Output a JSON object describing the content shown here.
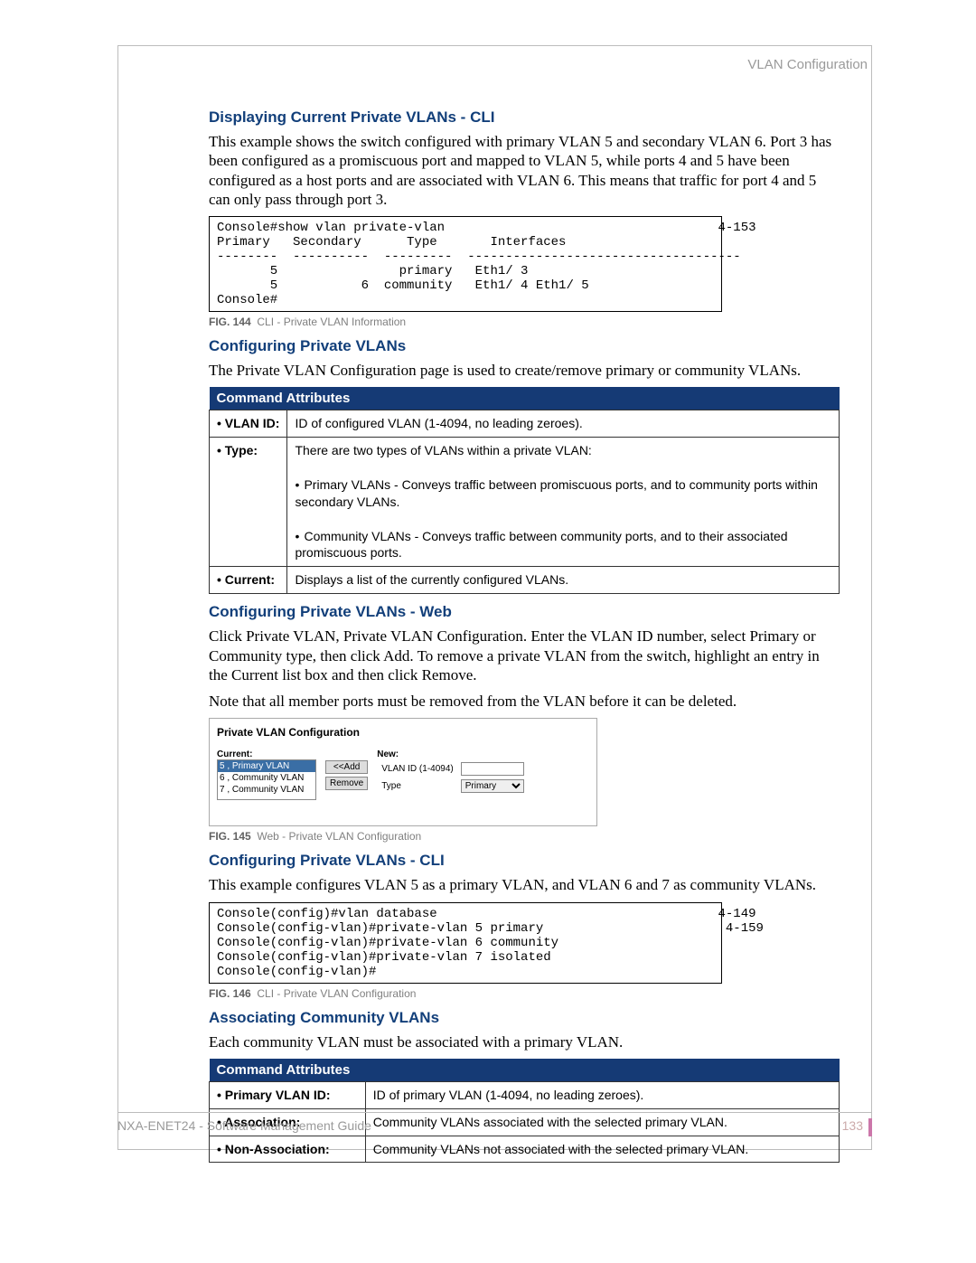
{
  "header": {
    "section": "VLAN Configuration"
  },
  "sections": {
    "s1": {
      "title": "Displaying Current Private VLANs - CLI",
      "para": "This example shows the switch configured with primary VLAN 5 and secondary VLAN 6. Port 3 has been configured as a promiscuous port and mapped to VLAN 5, while ports 4 and 5 have been configured as a host ports and are associated with VLAN 6. This means that traffic for port 4 and 5 can only pass through port 3."
    },
    "cli1": {
      "ref": "4-153",
      "text": "Console#show vlan private-vlan                                    4-153\nPrimary   Secondary      Type       Interfaces\n--------  ----------  ---------  ------------------------------------\n       5                primary   Eth1/ 3\n       5           6  community   Eth1/ 4 Eth1/ 5\nConsole#"
    },
    "fig144": {
      "num": "FIG. 144",
      "caption": "CLI - Private VLAN Information"
    },
    "s2": {
      "title": "Configuring Private VLANs",
      "para": "The Private VLAN Configuration page is used to create/remove primary or community VLANs."
    },
    "attr1": {
      "header": "Command Attributes",
      "rows": [
        {
          "label": "• VLAN ID:",
          "desc": "ID of configured VLAN (1-4094, no leading zeroes)."
        },
        {
          "label": "• Type:",
          "desc": "There are two types of VLANs within a private VLAN:",
          "sub": [
            "Primary VLANs - Conveys traffic between promiscuous ports, and to community ports within secondary VLANs.",
            "Community VLANs - Conveys traffic between community ports, and to their associated promiscuous ports."
          ]
        },
        {
          "label": "• Current:",
          "desc": "Displays a list of the currently configured VLANs."
        }
      ]
    },
    "s3": {
      "title": "Configuring Private VLANs - Web",
      "para1": "Click Private VLAN, Private VLAN Configuration. Enter the VLAN ID number, select Primary or Community type, then click Add. To remove a private VLAN from the switch, highlight an entry in the Current list box and then click Remove.",
      "para2": "Note that all member ports must be removed from the VLAN before it can be deleted."
    },
    "webshot": {
      "title": "Private VLAN Configuration",
      "currentLabel": "Current:",
      "newLabel": "New:",
      "listItems": [
        "5 , Primary VLAN",
        "6 , Community VLAN",
        "7 , Community VLAN"
      ],
      "addBtn": "<<Add",
      "removeBtn": "Remove",
      "vlanIdLabel": "VLAN ID (1-4094)",
      "typeLabel": "Type",
      "typeValue": "Primary"
    },
    "fig145": {
      "num": "FIG. 145",
      "caption": "Web - Private VLAN Configuration"
    },
    "s4": {
      "title": "Configuring Private VLANs - CLI",
      "para": "This example configures VLAN 5 as a primary VLAN, and VLAN 6 and 7 as community VLANs."
    },
    "cli2": {
      "text": "Console(config)#vlan database                                     4-149\nConsole(config-vlan)#private-vlan 5 primary                        4-159\nConsole(config-vlan)#private-vlan 6 community\nConsole(config-vlan)#private-vlan 7 isolated\nConsole(config-vlan)#"
    },
    "fig146": {
      "num": "FIG. 146",
      "caption": "CLI - Private VLAN Configuration"
    },
    "s5": {
      "title": "Associating Community VLANs",
      "para": "Each community VLAN must be associated with a primary VLAN."
    },
    "attr2": {
      "header": "Command Attributes",
      "rows": [
        {
          "label": "• Primary VLAN ID:",
          "desc": "ID of primary VLAN (1-4094, no leading zeroes)."
        },
        {
          "label": "• Association:",
          "desc": "Community VLANs associated with the selected primary VLAN."
        },
        {
          "label": "• Non-Association:",
          "desc": "Community VLANs not associated with the selected primary VLAN."
        }
      ]
    }
  },
  "footer": {
    "left": "NXA-ENET24 - Software Management Guide",
    "page": "133"
  }
}
